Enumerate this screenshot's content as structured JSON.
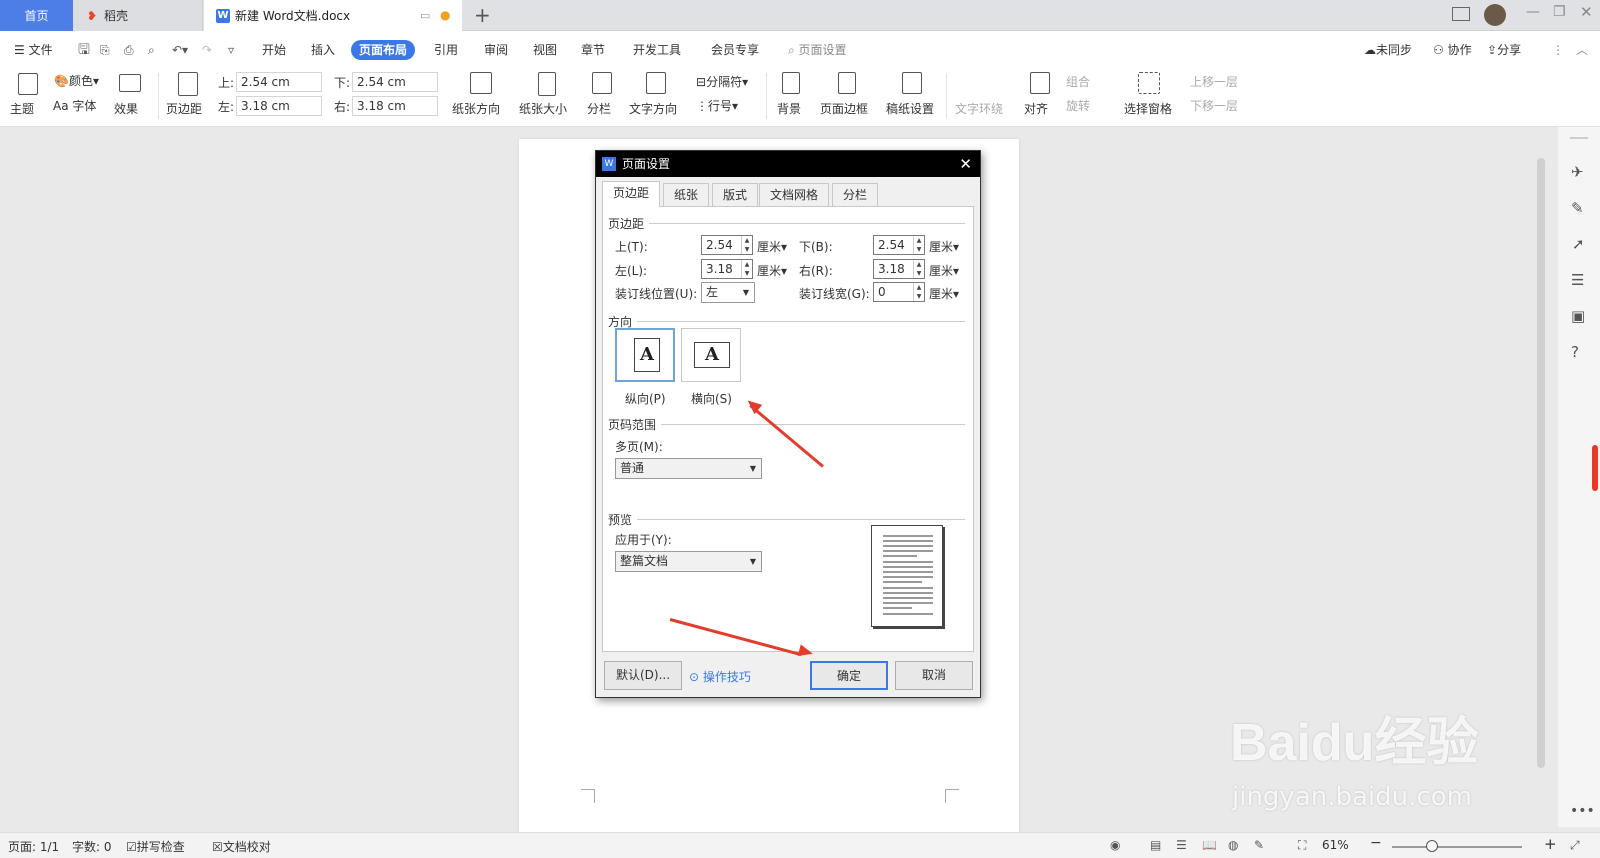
{
  "tabs": {
    "home": "首页",
    "daoke": "稻壳",
    "doc": "新建 Word文档.docx"
  },
  "menu": {
    "file": "文件",
    "start": "开始",
    "insert": "插入",
    "layout": "页面布局",
    "ref": "引用",
    "review": "审阅",
    "view": "视图",
    "chapter": "章节",
    "dev": "开发工具",
    "vip": "会员专享",
    "search": "页面设置",
    "sync": "未同步",
    "collab": "协作",
    "share": "分享"
  },
  "ribbon": {
    "theme": "主题",
    "color": "颜色",
    "font": "Aa 字体",
    "effect": "效果",
    "margin": "页边距",
    "top_label": "上:",
    "top_val": "2.54 cm",
    "bottom_label": "下:",
    "bottom_val": "2.54 cm",
    "left_label": "左:",
    "left_val": "3.18 cm",
    "right_label": "右:",
    "right_val": "3.18 cm",
    "orient": "纸张方向",
    "size": "纸张大小",
    "columns": "分栏",
    "textdir": "文字方向",
    "breaks": "分隔符",
    "linenum": "行号",
    "bg": "背景",
    "border": "页面边框",
    "draft": "稿纸设置",
    "wrap": "文字环绕",
    "align": "对齐",
    "group": "组合",
    "rotate": "旋转",
    "select": "选择窗格",
    "up": "上移一层",
    "down": "下移一层"
  },
  "dialog": {
    "title": "页面设置",
    "tabs": [
      "页边距",
      "纸张",
      "版式",
      "文档网格",
      "分栏"
    ],
    "margins_section": "页边距",
    "top": {
      "label": "上(T):",
      "value": "2.54",
      "unit": "厘米"
    },
    "bottom": {
      "label": "下(B):",
      "value": "2.54",
      "unit": "厘米"
    },
    "left": {
      "label": "左(L):",
      "value": "3.18",
      "unit": "厘米"
    },
    "right": {
      "label": "右(R):",
      "value": "3.18",
      "unit": "厘米"
    },
    "gutter_pos": {
      "label": "装订线位置(U):",
      "value": "左"
    },
    "gutter": {
      "label": "装订线宽(G):",
      "value": "0",
      "unit": "厘米"
    },
    "orient_section": "方向",
    "portrait": "纵向(P)",
    "landscape": "横向(S)",
    "page_glyph": "A",
    "range_section": "页码范围",
    "multi_label": "多页(M):",
    "multi_value": "普通",
    "preview_section": "预览",
    "apply_label": "应用于(Y):",
    "apply_value": "整篇文档",
    "default_btn": "默认(D)...",
    "tips": "操作技巧",
    "ok": "确定",
    "cancel": "取消"
  },
  "status": {
    "page": "页面: 1/1",
    "words": "字数: 0",
    "spell": "拼写检查",
    "proof": "文档校对",
    "zoom": "61%"
  },
  "watermark": {
    "logo": "Baidu经验",
    "url": "jingyan.baidu.com"
  },
  "colors": {
    "accent": "#3b78e7",
    "arrow": "#e53b2a",
    "dialog_title": "#000000"
  }
}
